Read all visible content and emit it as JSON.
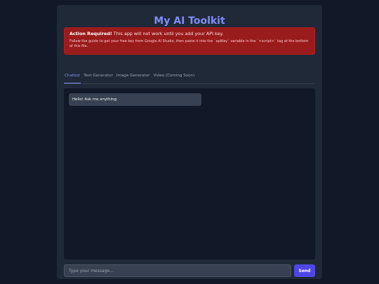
{
  "app": {
    "title": "My AI Toolkit"
  },
  "alert": {
    "heading": "Action Required!",
    "message": " This app will not work until you add your API key.",
    "detail": "Follow the guide to get your free key from Google AI Studio, then paste it into the `apiKey` variable in the `<script>` tag at the bottom of this file."
  },
  "tabs": [
    {
      "label": "Chatbot",
      "active": true
    },
    {
      "label": "Text Generator",
      "active": false
    },
    {
      "label": "Image Generator",
      "active": false
    },
    {
      "label": "Video (Coming Soon)",
      "active": false
    }
  ],
  "chat": {
    "messages": [
      {
        "role": "bot",
        "text": "Hello! Ask me anything."
      }
    ]
  },
  "composer": {
    "placeholder": "Type your message...",
    "value": "",
    "send_label": "Send"
  },
  "colors": {
    "background": "#111827",
    "panel": "#1f2937",
    "accent": "#818cf8",
    "button": "#4f46e5",
    "alert": "#991b1b"
  }
}
